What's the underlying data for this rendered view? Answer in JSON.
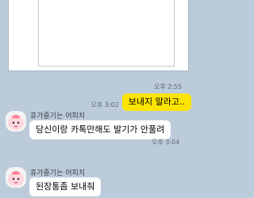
{
  "messages": {
    "first_time": "오후 2:55",
    "reply_time": "오후 3:02",
    "reply_text": "보내지 말라고..",
    "sender_name": "휴가즐기는 어피치",
    "incoming1_text": "당신이랑 카톡만해도 발기가 안풀려",
    "incoming1_time": "오후 3:04",
    "incoming2_text": "된장통좀 보내줘"
  },
  "colors": {
    "background": "#bccbda",
    "outgoing_bubble": "#fee500",
    "incoming_bubble": "#ffffff"
  },
  "icons": {
    "avatar": "apeach-character-icon"
  }
}
